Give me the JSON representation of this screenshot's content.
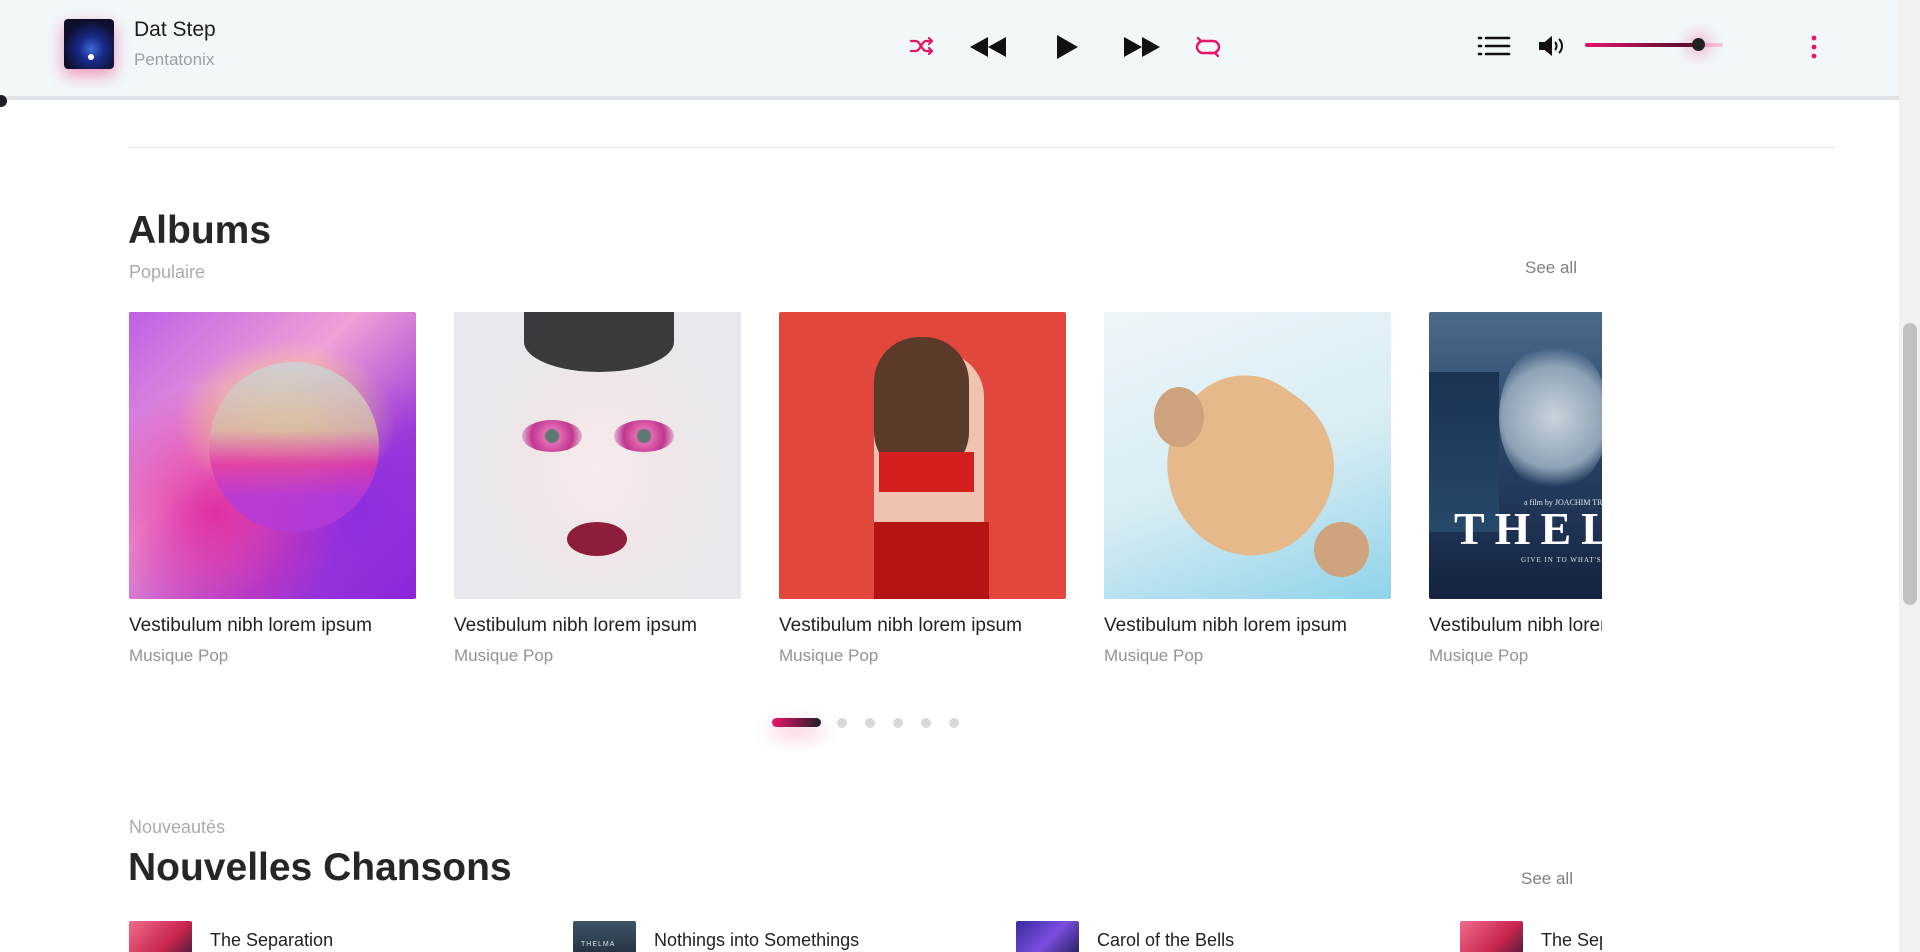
{
  "player": {
    "title": "Dat Step",
    "artist": "Pentatonix",
    "accent_color": "#e8156b",
    "volume_percent": 82,
    "icons": [
      "shuffle-icon",
      "rewind-icon",
      "play-icon",
      "fast-forward-icon",
      "repeat-icon",
      "playlist-icon",
      "volume-icon",
      "more-vertical-icon"
    ]
  },
  "albums": {
    "heading": "Albums",
    "subheading": "Populaire",
    "see_all": "See all",
    "items": [
      {
        "title": "Vestibulum nibh lorem ipsum",
        "genre": "Musique Pop"
      },
      {
        "title": "Vestibulum nibh lorem ipsum",
        "genre": "Musique Pop"
      },
      {
        "title": "Vestibulum nibh lorem ipsum",
        "genre": "Musique Pop"
      },
      {
        "title": "Vestibulum nibh lorem ipsum",
        "genre": "Musique Pop"
      },
      {
        "title": "Vestibulum nibh lorem ipsum",
        "genre": "Musique Pop",
        "poster_title": "THEL",
        "poster_byline": "a film by JOACHIM TR",
        "poster_tagline": "GIVE IN TO WHAT'S UND"
      }
    ],
    "pager": {
      "count": 6,
      "active": 1
    }
  },
  "songs": {
    "subheading": "Nouveautés",
    "heading": "Nouvelles Chansons",
    "see_all": "See all",
    "items": [
      {
        "name": "The Separation",
        "thumb_color": "#e4406a"
      },
      {
        "name": "Nothings into Somethings",
        "thumb_color": "#2c3e50",
        "thumb_text": "THELMA"
      },
      {
        "name": "Carol of the Bells",
        "thumb_color": "#5a34c8"
      },
      {
        "name": "The Sep",
        "thumb_color": "#e4406a"
      }
    ]
  }
}
